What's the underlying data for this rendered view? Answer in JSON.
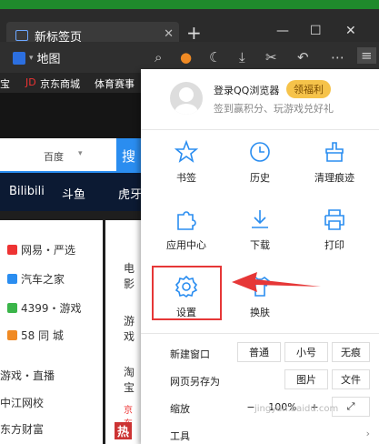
{
  "browser": {
    "tab_title": "新标签页",
    "toolbar_map_label": "地图"
  },
  "bookmarks": [
    "宝",
    "京东商城",
    "体育赛事"
  ],
  "page": {
    "search_engine": "百度",
    "search_button": "搜",
    "nav": [
      "Bilibili",
      "斗鱼",
      "虎牙"
    ],
    "links": [
      "网易・严选",
      "汽车之家",
      "4399・游戏",
      "58 同 城",
      "游戏・直播",
      "中江网校",
      "东方财富"
    ],
    "side_items": [
      "电影",
      "游戏",
      "淘宝",
      "京东",
      "热"
    ]
  },
  "menu": {
    "login_text": "登录QQ浏览器",
    "welfare_badge": "领福利",
    "signin_text": "签到赢积分、玩游戏兑好礼",
    "grid": [
      "书签",
      "历史",
      "清理痕迹",
      "应用中心",
      "下载",
      "打印",
      "设置",
      "换肤"
    ],
    "rows": {
      "new_window": {
        "label": "新建窗口",
        "options": [
          "普通",
          "小号",
          "无痕"
        ]
      },
      "save_as": {
        "label": "网页另存为",
        "options": [
          "图片",
          "文件"
        ]
      },
      "zoom": {
        "label": "缩放",
        "minus": "−",
        "value": "100%",
        "plus": "+"
      },
      "tools": {
        "label": "工具"
      }
    }
  },
  "watermark": "jingyan.baidu.com",
  "colors": {
    "accent": "#2a8df0",
    "highlight": "#e63737",
    "badge": "#f6c34a"
  }
}
